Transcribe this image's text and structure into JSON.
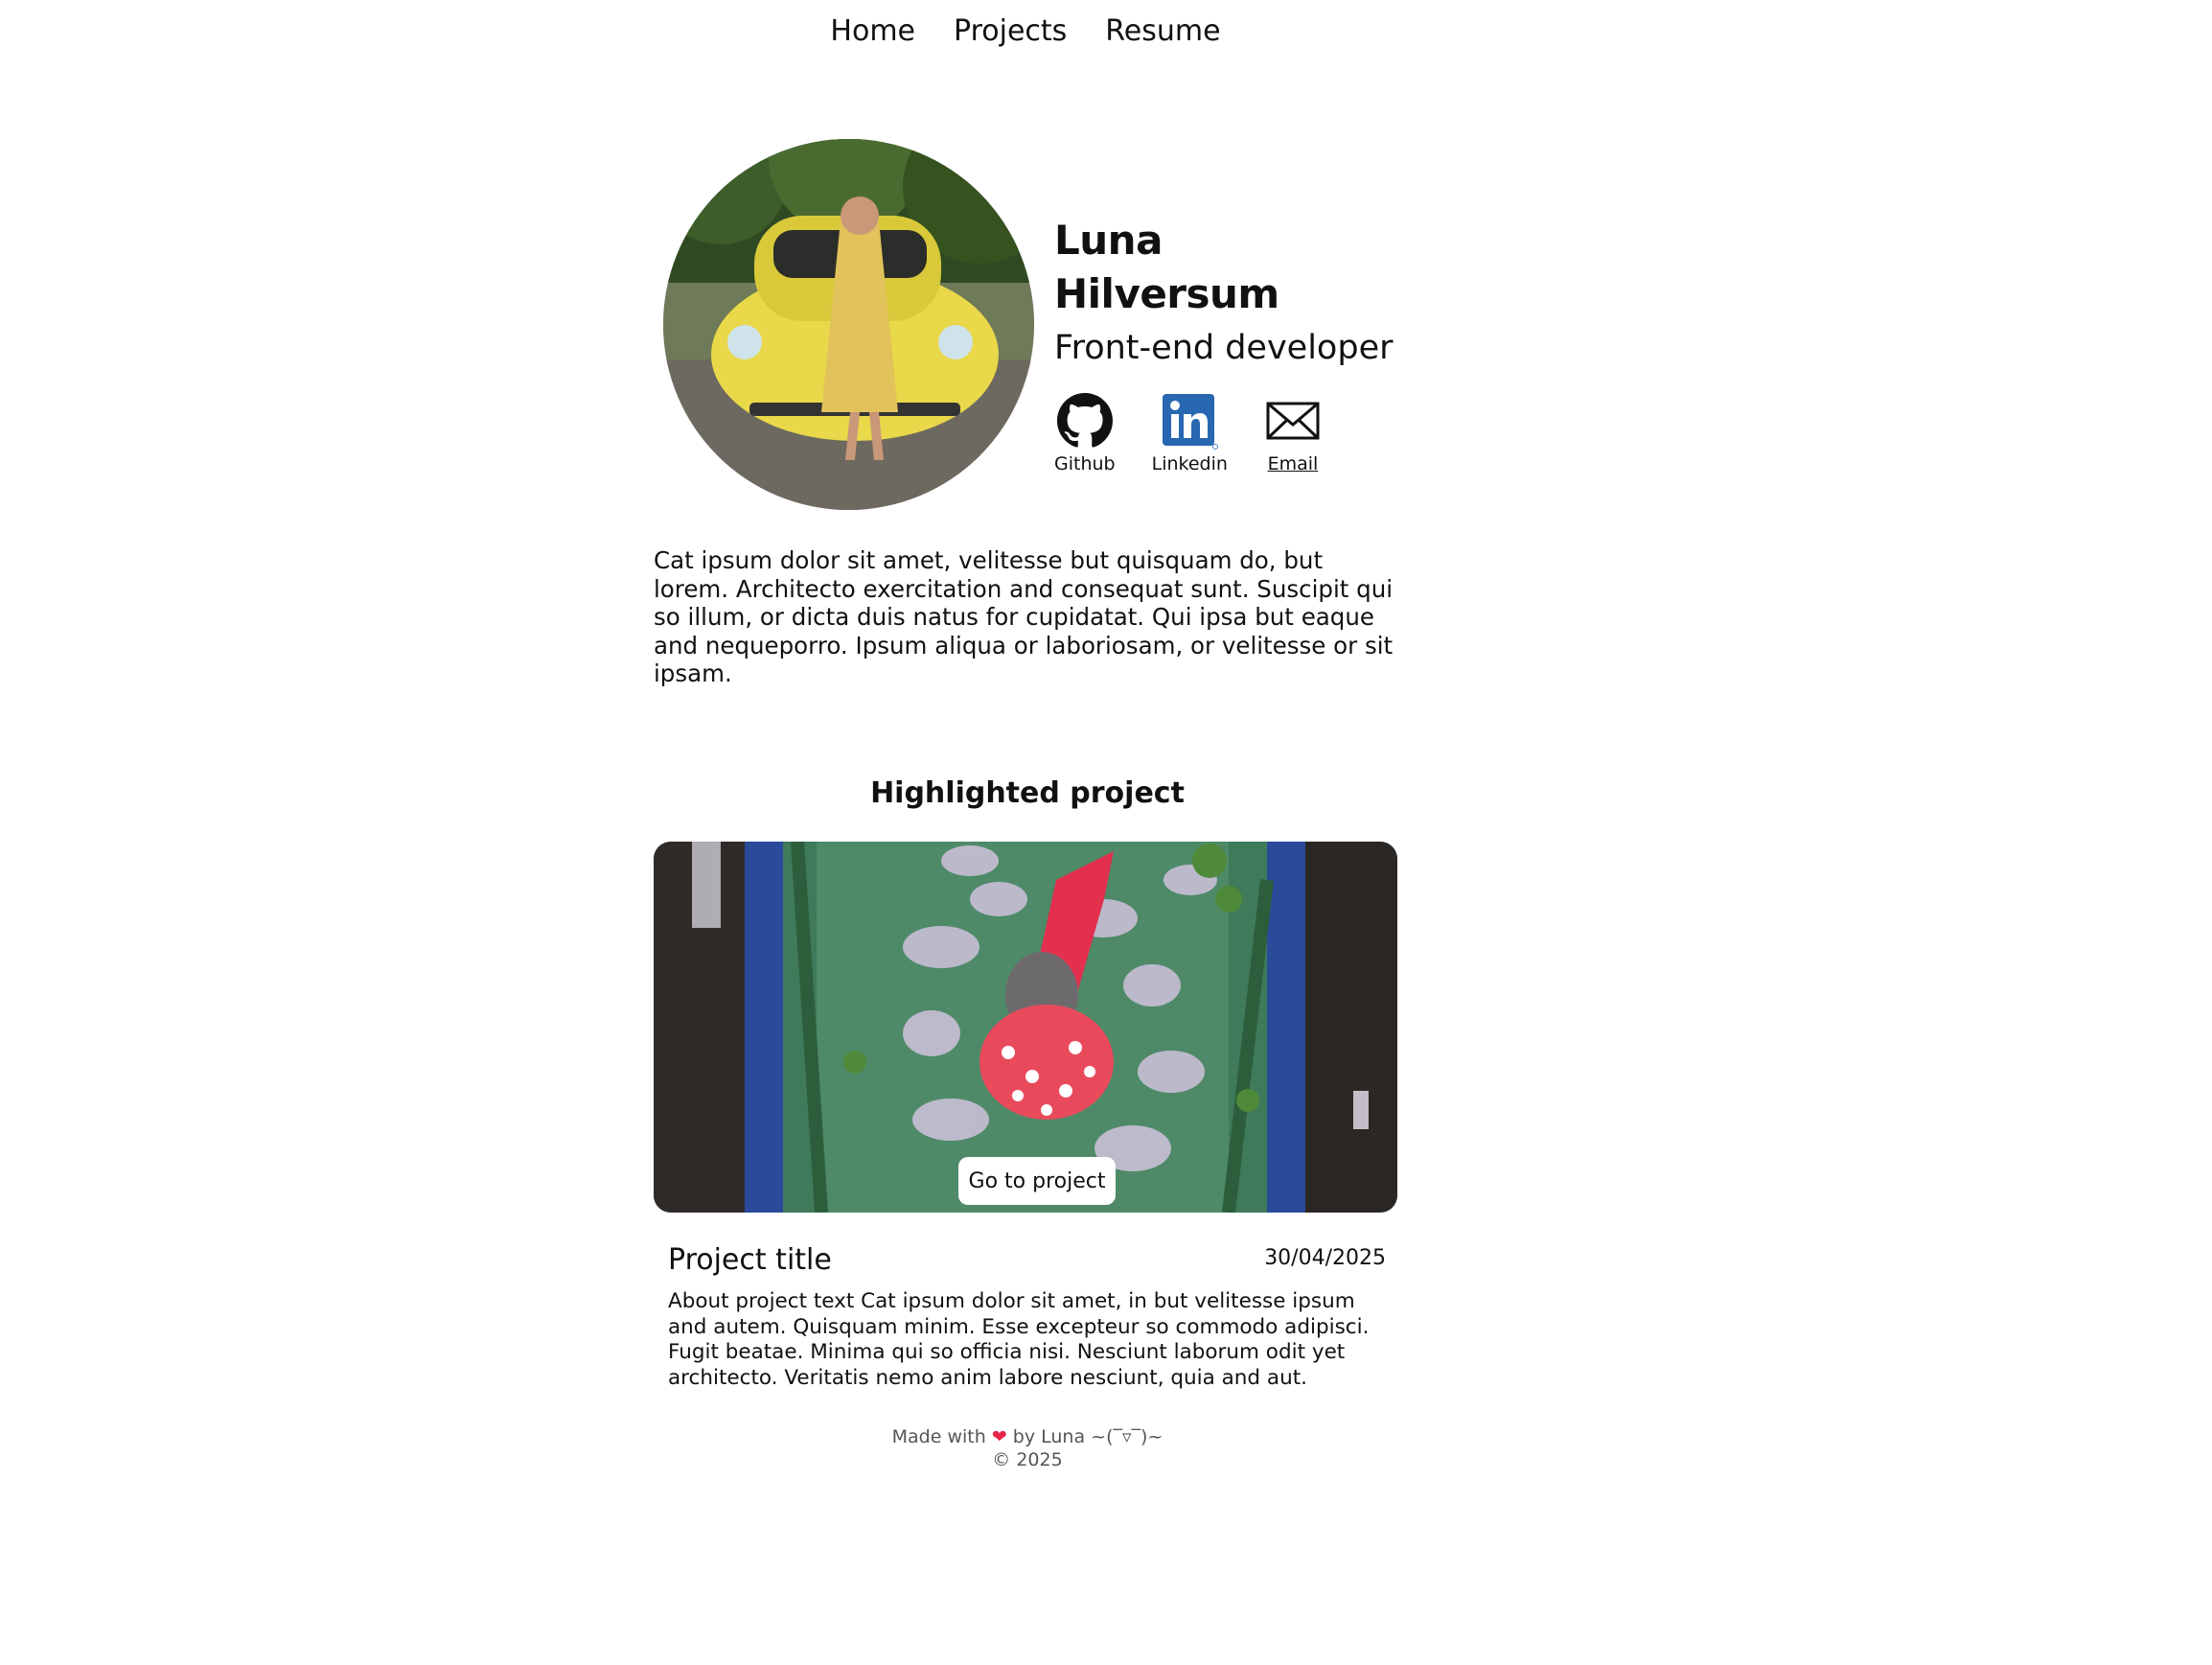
{
  "nav": {
    "items": [
      {
        "label": "Home"
      },
      {
        "label": "Projects"
      },
      {
        "label": "Resume"
      }
    ]
  },
  "profile": {
    "name": "Luna Hilversum",
    "role": "Front-end developer",
    "socials": [
      {
        "label": "Github",
        "icon": "github-icon"
      },
      {
        "label": "Linkedin",
        "icon": "linkedin-icon"
      },
      {
        "label": "Email",
        "icon": "envelope-icon"
      }
    ]
  },
  "about": {
    "text": "Cat ipsum dolor sit amet, velitesse but quisquam do, but lorem. Architecto exercitation and consequat sunt. Suscipit qui so illum, or dicta duis natus for cupidatat. Qui ipsa but eaque and nequeporro. Ipsum aliqua or laboriosam, or velitesse or sit ipsam."
  },
  "highlight": {
    "section_title": "Highlighted project",
    "button_label": "Go to project",
    "project_title": "Project title",
    "date": "30/04/2025",
    "description": "About project text Cat ipsum dolor sit amet, in but velitesse ipsum and autem. Quisquam minim. Esse excepteur so commodo adipisci. Fugit beatae. Minima qui so officia nisi. Nesciunt laborum odit yet architecto. Veritatis nemo anim labore nesciunt, quia and aut."
  },
  "footer": {
    "made_with": "Made with",
    "heart": "❤",
    "by": "by Luna ~(‾▿‾)~",
    "copyright": "© 2025"
  },
  "colors": {
    "linkedin": "#2867B2",
    "heart": "#e8264a",
    "text": "#111111"
  }
}
